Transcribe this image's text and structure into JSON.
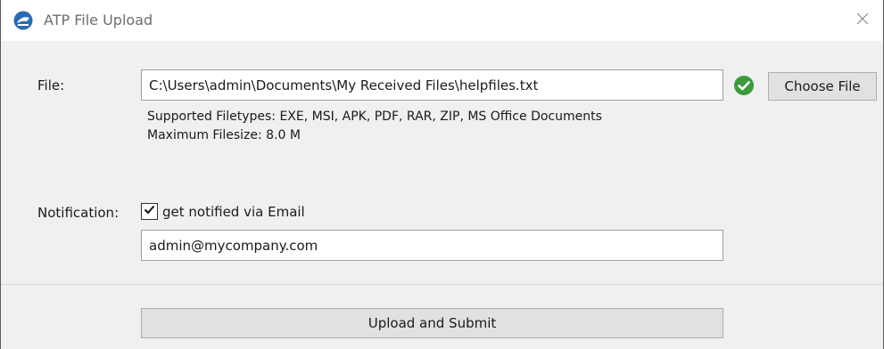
{
  "window": {
    "title": "ATP File Upload",
    "icon": "atp-app-icon",
    "close_icon": "close-icon"
  },
  "file": {
    "label": "File:",
    "value": "C:\\Users\\admin\\Documents\\My Received Files\\helpfiles.txt",
    "status_icon": "check-circle-icon",
    "status_color": "#3c9a3c",
    "choose_button": "Choose File",
    "supported_types": "Supported Filetypes: EXE, MSI, APK, PDF, RAR, ZIP, MS Office Documents",
    "max_size": "Maximum Filesize: 8.0 M"
  },
  "notification": {
    "label": "Notification:",
    "checkbox_label": "get notified via Email",
    "checked": true,
    "email_value": "admin@mycompany.com"
  },
  "footer": {
    "submit_button": "Upload and Submit"
  }
}
